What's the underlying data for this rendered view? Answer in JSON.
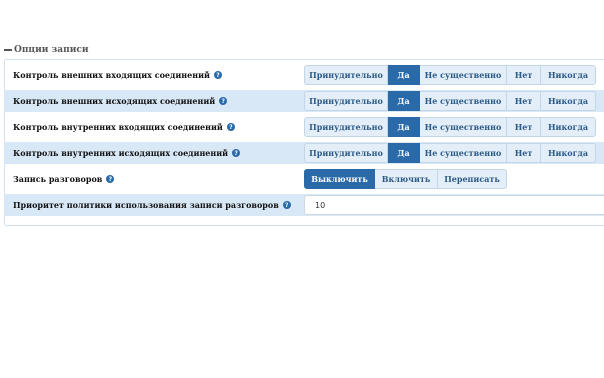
{
  "section": {
    "title": "Опции записи"
  },
  "rows": [
    {
      "label": "Контроль внешних входящих соединений",
      "options": [
        "Принудительно",
        "Да",
        "Не существенно",
        "Нет",
        "Никогда"
      ],
      "selected": "Да"
    },
    {
      "label": "Контроль внешних исходящих соединений",
      "options": [
        "Принудительно",
        "Да",
        "Не существенно",
        "Нет",
        "Никогда"
      ],
      "selected": "Да"
    },
    {
      "label": "Контроль внутренних входящих соединений",
      "options": [
        "Принудительно",
        "Да",
        "Не существенно",
        "Нет",
        "Никогда"
      ],
      "selected": "Да"
    },
    {
      "label": "Контроль внутренних исходящих соединений",
      "options": [
        "Принудительно",
        "Да",
        "Не существенно",
        "Нет",
        "Никогда"
      ],
      "selected": "Да"
    },
    {
      "label": "Запись разговоров",
      "options": [
        "Выключить",
        "Включить",
        "Переписать"
      ],
      "selected": "Выключить"
    },
    {
      "label": "Приоритет политики использования записи разговоров",
      "value": "10"
    }
  ],
  "help_icon_glyph": "?",
  "colors": {
    "accent": "#2a6aa8",
    "row_shade": "#d9e8f6",
    "button_bg": "#e4eef8"
  }
}
